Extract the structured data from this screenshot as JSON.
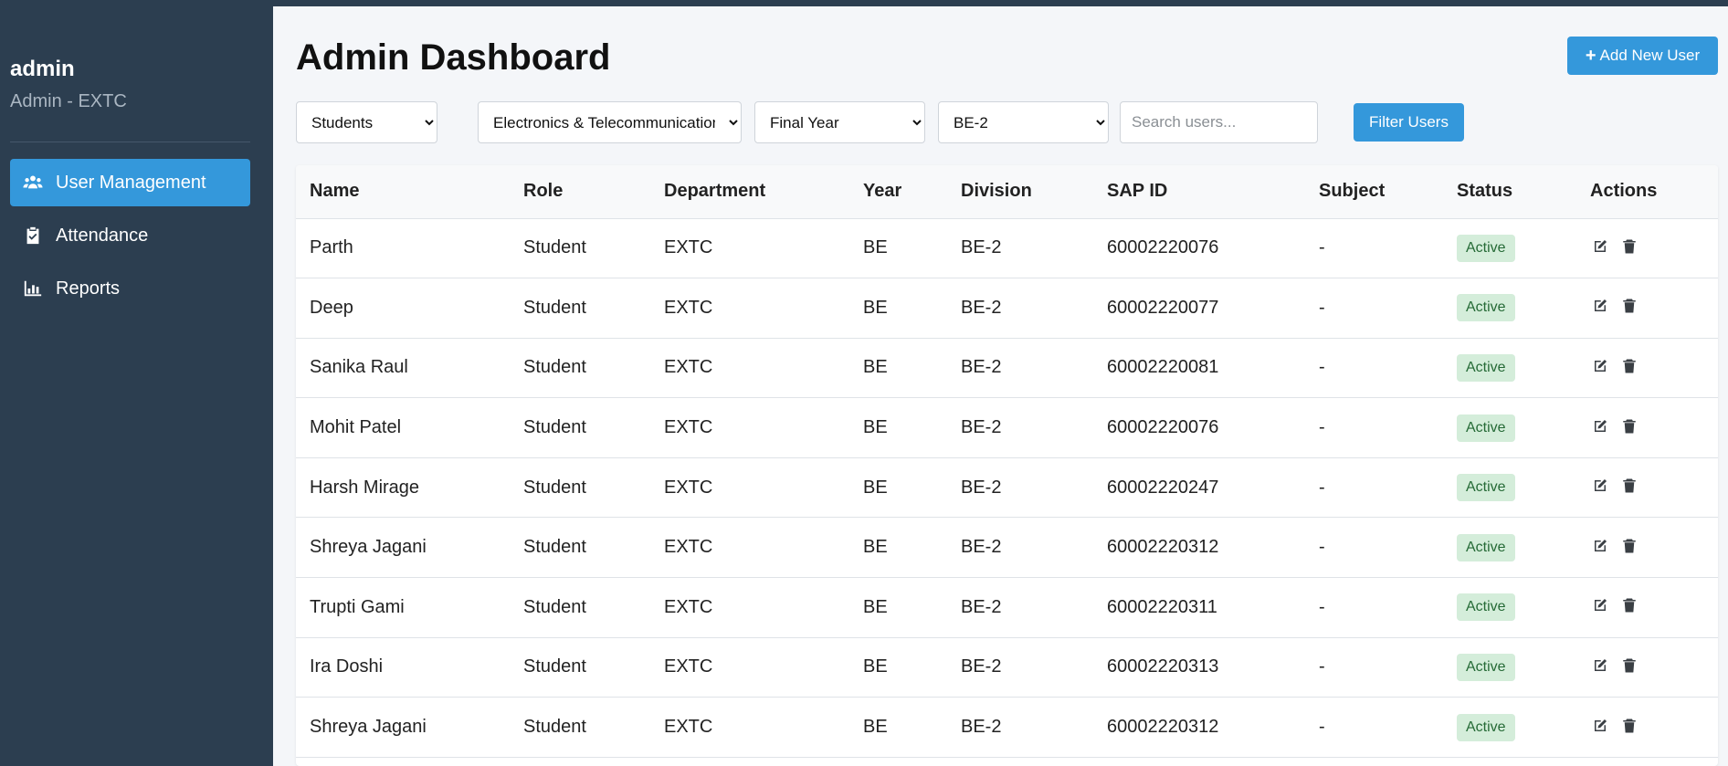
{
  "sidebar": {
    "user_name": "admin",
    "user_role": "Admin - EXTC",
    "items": [
      {
        "label": "User Management",
        "icon": "users-icon",
        "active": true
      },
      {
        "label": "Attendance",
        "icon": "clipboard-check-icon",
        "active": false
      },
      {
        "label": "Reports",
        "icon": "chart-bar-icon",
        "active": false
      }
    ]
  },
  "header": {
    "title": "Admin Dashboard",
    "add_button_label": "Add New User",
    "add_button_icon": "plus-icon"
  },
  "filters": {
    "role": {
      "selected": "Students"
    },
    "department": {
      "selected": "Electronics & Telecommunication"
    },
    "year": {
      "selected": "Final Year"
    },
    "division": {
      "selected": "BE-2"
    },
    "search": {
      "value": "",
      "placeholder": "Search users..."
    },
    "filter_button_label": "Filter Users"
  },
  "table": {
    "columns": [
      "Name",
      "Role",
      "Department",
      "Year",
      "Division",
      "SAP ID",
      "Subject",
      "Status",
      "Actions"
    ],
    "rows": [
      {
        "name": "Parth",
        "role": "Student",
        "department": "EXTC",
        "year": "BE",
        "division": "BE-2",
        "sap_id": "60002220076",
        "subject": "-",
        "status": "Active"
      },
      {
        "name": "Deep",
        "role": "Student",
        "department": "EXTC",
        "year": "BE",
        "division": "BE-2",
        "sap_id": "60002220077",
        "subject": "-",
        "status": "Active"
      },
      {
        "name": "Sanika Raul",
        "role": "Student",
        "department": "EXTC",
        "year": "BE",
        "division": "BE-2",
        "sap_id": "60002220081",
        "subject": "-",
        "status": "Active"
      },
      {
        "name": "Mohit Patel",
        "role": "Student",
        "department": "EXTC",
        "year": "BE",
        "division": "BE-2",
        "sap_id": "60002220076",
        "subject": "-",
        "status": "Active"
      },
      {
        "name": "Harsh Mirage",
        "role": "Student",
        "department": "EXTC",
        "year": "BE",
        "division": "BE-2",
        "sap_id": "60002220247",
        "subject": "-",
        "status": "Active"
      },
      {
        "name": "Shreya Jagani",
        "role": "Student",
        "department": "EXTC",
        "year": "BE",
        "division": "BE-2",
        "sap_id": "60002220312",
        "subject": "-",
        "status": "Active"
      },
      {
        "name": "Trupti Gami",
        "role": "Student",
        "department": "EXTC",
        "year": "BE",
        "division": "BE-2",
        "sap_id": "60002220311",
        "subject": "-",
        "status": "Active"
      },
      {
        "name": "Ira Doshi",
        "role": "Student",
        "department": "EXTC",
        "year": "BE",
        "division": "BE-2",
        "sap_id": "60002220313",
        "subject": "-",
        "status": "Active"
      },
      {
        "name": "Shreya Jagani",
        "role": "Student",
        "department": "EXTC",
        "year": "BE",
        "division": "BE-2",
        "sap_id": "60002220312",
        "subject": "-",
        "status": "Active"
      }
    ]
  },
  "colors": {
    "sidebar_bg": "#2c3e50",
    "accent": "#3498db",
    "status_active_bg": "#d4edda",
    "status_active_text": "#256a36"
  }
}
